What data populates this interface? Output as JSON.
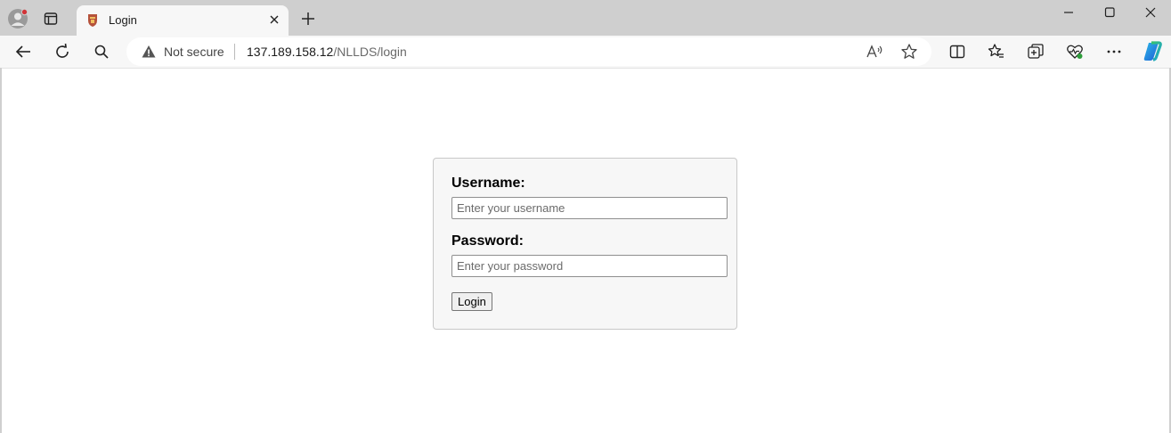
{
  "browser": {
    "tab": {
      "title": "Login"
    },
    "address_bar": {
      "security_label": "Not secure",
      "url_host": "137.189.158.12",
      "url_path": "/NLLDS/login"
    }
  },
  "login_form": {
    "username_label": "Username:",
    "username_placeholder": "Enter your username",
    "username_value": "",
    "password_label": "Password:",
    "password_placeholder": "Enter your password",
    "password_value": "",
    "submit_label": "Login"
  },
  "icons": {
    "profile": "profile-icon",
    "tab_actions": "tab-actions-icon",
    "favicon": "site-crest-icon",
    "tab_close": "close-icon",
    "new_tab": "plus-icon",
    "minimize": "minimize-icon",
    "maximize": "maximize-icon",
    "close_window": "close-icon",
    "back": "back-arrow-icon",
    "refresh": "refresh-icon",
    "search": "search-icon",
    "warning": "warning-icon",
    "read_aloud": "read-aloud-icon",
    "favorite": "star-icon",
    "split_screen": "split-screen-icon",
    "favorites": "favorites-icon",
    "collections": "collections-icon",
    "performance": "heart-pulse-icon",
    "more": "more-icon",
    "copilot": "copilot-icon"
  },
  "colors": {
    "chrome_bg": "#cfcfcf",
    "toolbar_bg": "#f7f7f7",
    "form_bg": "#f7f7f7",
    "profile_badge": "#d13438",
    "favicon": "#b5523b"
  }
}
